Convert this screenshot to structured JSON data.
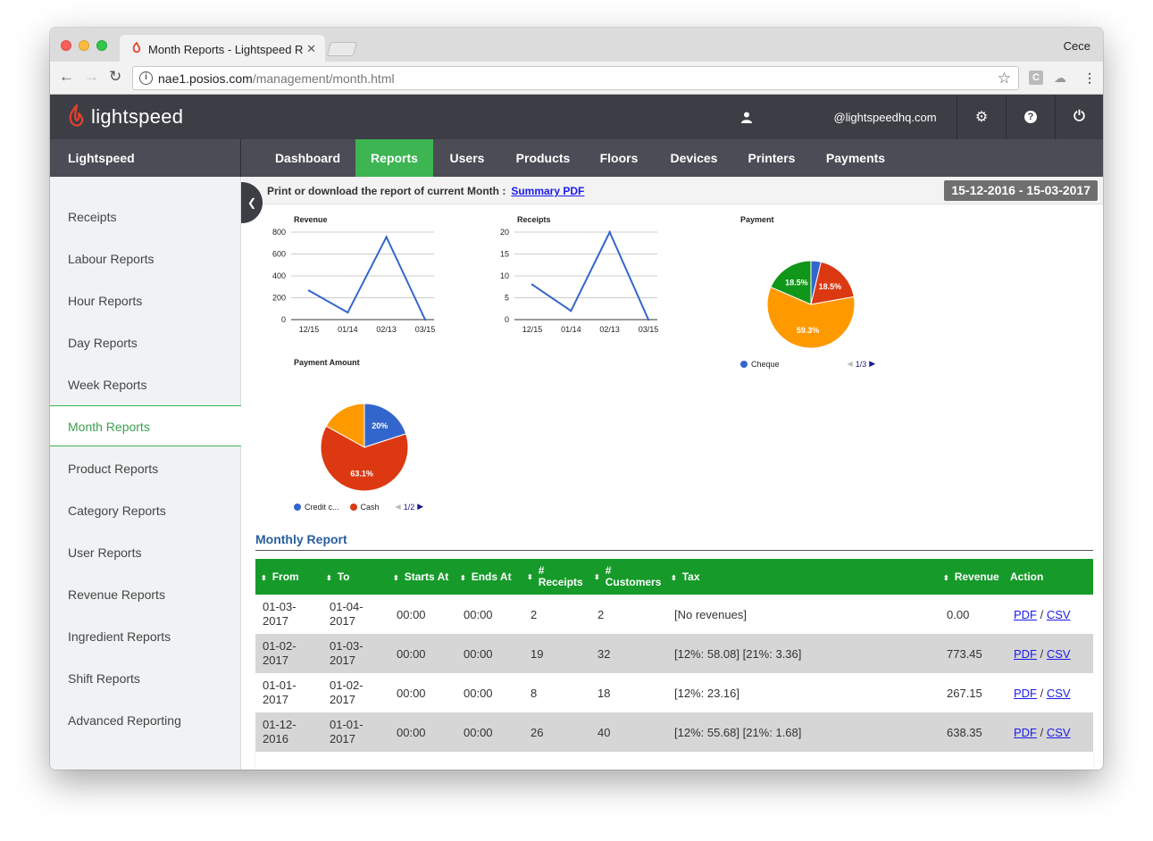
{
  "browser": {
    "tab_title": "Month Reports - Lightspeed R",
    "profile": "Cece",
    "url_host": "nae1.posios.com",
    "url_path": "/management/month.html"
  },
  "header": {
    "logo_text": "lightspeed",
    "user_email": "@lightspeedhq.com"
  },
  "nav": {
    "brand": "Lightspeed",
    "tabs": [
      {
        "label": "Dashboard"
      },
      {
        "label": "Reports",
        "active": true
      },
      {
        "label": "Users"
      },
      {
        "label": "Products"
      },
      {
        "label": "Floors"
      },
      {
        "label": "Devices"
      },
      {
        "label": "Printers"
      },
      {
        "label": "Payments"
      }
    ]
  },
  "sidebar": {
    "items": [
      {
        "label": "Receipts"
      },
      {
        "label": "Labour Reports"
      },
      {
        "label": "Hour Reports"
      },
      {
        "label": "Day Reports"
      },
      {
        "label": "Week Reports"
      },
      {
        "label": "Month Reports",
        "active": true
      },
      {
        "label": "Product Reports"
      },
      {
        "label": "Category Reports"
      },
      {
        "label": "User Reports"
      },
      {
        "label": "Revenue Reports"
      },
      {
        "label": "Ingredient Reports"
      },
      {
        "label": "Shift Reports"
      },
      {
        "label": "Advanced Reporting"
      }
    ]
  },
  "infobar": {
    "text": "Print or download the report of current Month :",
    "link": "Summary PDF",
    "date_range": "15-12-2016 - 15-03-2017"
  },
  "chart_data": [
    {
      "type": "line",
      "title": "Revenue",
      "categories": [
        "12/15",
        "01/14",
        "02/13",
        "03/15"
      ],
      "x": [
        "12/15",
        "01/14",
        "02/13",
        "03/15"
      ],
      "values": [
        265,
        65,
        755,
        0
      ],
      "ylim": [
        0,
        800
      ],
      "yticks": [
        0,
        200,
        400,
        600,
        800
      ],
      "color": "#3366cc",
      "grid": true
    },
    {
      "type": "line",
      "title": "Receipts",
      "categories": [
        "12/15",
        "01/14",
        "02/13",
        "03/15"
      ],
      "x": [
        "12/15",
        "01/14",
        "02/13",
        "03/15"
      ],
      "values": [
        8,
        2,
        20,
        0
      ],
      "ylim": [
        0,
        20
      ],
      "yticks": [
        0,
        5,
        10,
        15,
        20
      ],
      "color": "#3366cc",
      "grid": true
    },
    {
      "type": "pie",
      "title": "Payment",
      "slices": [
        {
          "label": "Cheque",
          "value": 3.7,
          "color": "#3366cc"
        },
        {
          "value": 18.5,
          "color": "#dc3912"
        },
        {
          "value": 59.3,
          "color": "#ff9900"
        },
        {
          "value": 18.5,
          "color": "#109618"
        }
      ],
      "slice_labels": [
        "18.5%",
        "59.3%"
      ],
      "legend_visible": [
        "Cheque"
      ],
      "pager": "1/3"
    },
    {
      "type": "pie",
      "title": "Payment Amount",
      "slices": [
        {
          "label": "Credit c...",
          "value": 20,
          "color": "#3366cc"
        },
        {
          "label": "Cash",
          "value": 63.1,
          "color": "#dc3912"
        },
        {
          "value": 16.9,
          "color": "#ff9900"
        }
      ],
      "slice_labels": [
        "20%",
        "63.1%"
      ],
      "legend_visible": [
        "Credit c...",
        "Cash"
      ],
      "pager": "1/2"
    }
  ],
  "report": {
    "title": "Monthly Report",
    "columns": [
      "From",
      "To",
      "Starts At",
      "Ends At",
      "# Receipts",
      "# Customers",
      "Tax",
      "Revenue",
      "Action"
    ],
    "rows": [
      {
        "from": "01-03-2017",
        "to": "01-04-2017",
        "starts": "00:00",
        "ends": "00:00",
        "receipts": "2",
        "customers": "2",
        "tax": "[No revenues]",
        "revenue": "0.00"
      },
      {
        "from": "01-02-2017",
        "to": "01-03-2017",
        "starts": "00:00",
        "ends": "00:00",
        "receipts": "19",
        "customers": "32",
        "tax": "[12%: 58.08] [21%: 3.36]",
        "revenue": "773.45"
      },
      {
        "from": "01-01-2017",
        "to": "01-02-2017",
        "starts": "00:00",
        "ends": "00:00",
        "receipts": "8",
        "customers": "18",
        "tax": "[12%: 23.16]",
        "revenue": "267.15"
      },
      {
        "from": "01-12-2016",
        "to": "01-01-2017",
        "starts": "00:00",
        "ends": "00:00",
        "receipts": "26",
        "customers": "40",
        "tax": "[12%: 55.68] [21%: 1.68]",
        "revenue": "638.35"
      }
    ],
    "action_pdf": "PDF",
    "action_sep": "/",
    "action_csv": "CSV"
  },
  "colors": {
    "accent_green": "#3db552",
    "table_header": "#169a2a",
    "header_dark": "#3d3e45",
    "logo_red": "#e8412c"
  }
}
